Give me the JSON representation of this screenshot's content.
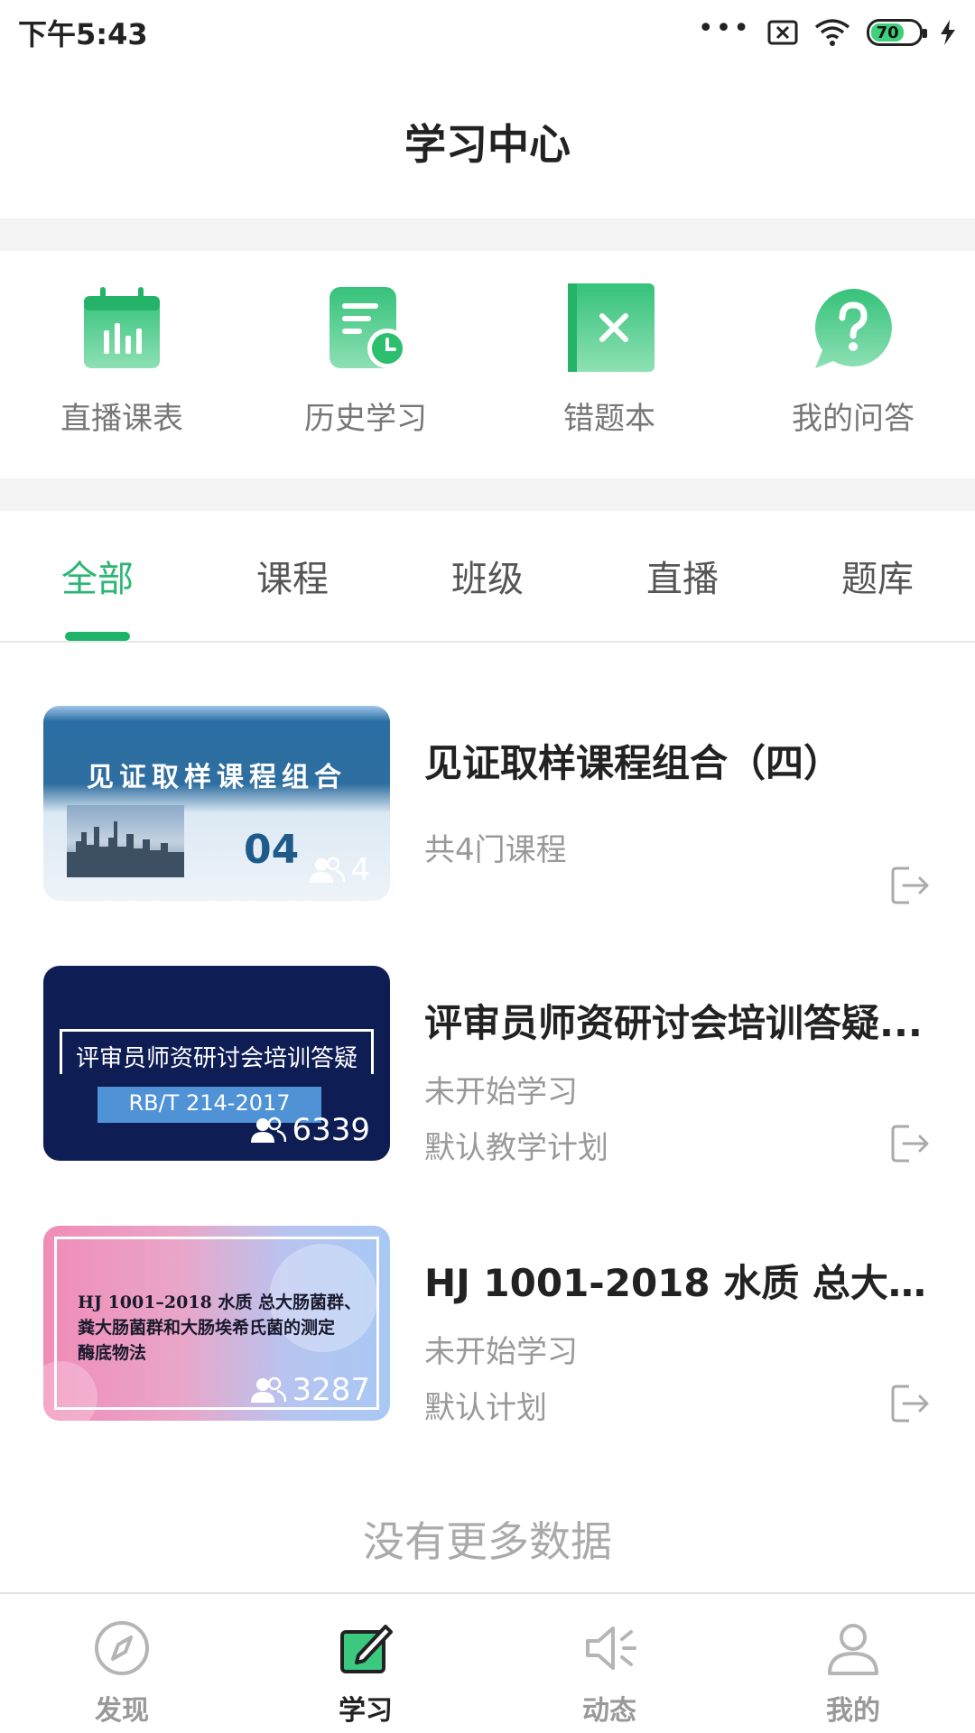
{
  "status_bar": {
    "time": "下午5:43",
    "battery": "70"
  },
  "header": {
    "title": "学习中心"
  },
  "shortcuts": [
    {
      "label": "直播课表",
      "icon": "calendar-chart-icon"
    },
    {
      "label": "历史学习",
      "icon": "history-clock-icon"
    },
    {
      "label": "错题本",
      "icon": "wrong-book-icon"
    },
    {
      "label": "我的问答",
      "icon": "question-bubble-icon"
    }
  ],
  "tabs": [
    {
      "label": "全部",
      "active": true
    },
    {
      "label": "课程",
      "active": false
    },
    {
      "label": "班级",
      "active": false
    },
    {
      "label": "直播",
      "active": false
    },
    {
      "label": "题库",
      "active": false
    }
  ],
  "courses": [
    {
      "title": "见证取样课程组合（四）",
      "lines": [
        "共4门课程"
      ],
      "thumb_title": "见证取样课程组合",
      "thumb_number": "04",
      "thumb_users": "4"
    },
    {
      "title": "评审员师资研讨会培训答疑...",
      "lines": [
        "未开始学习",
        "默认教学计划"
      ],
      "thumb_title": "评审员师资研讨会培训答疑",
      "thumb_code": "RB/T 214-2017",
      "thumb_users": "6339"
    },
    {
      "title": "HJ 1001-2018 水质 总大肠...",
      "lines": [
        "未开始学习",
        "默认计划"
      ],
      "thumb_title_lines": [
        "HJ 1001–2018 水质 总大肠菌群、",
        "粪大肠菌群和大肠埃希氏菌的测定",
        "酶底物法"
      ],
      "thumb_users": "3287"
    }
  ],
  "footer": {
    "no_more": "没有更多数据"
  },
  "bottom_nav": [
    {
      "label": "发现",
      "icon": "compass-icon",
      "active": false
    },
    {
      "label": "学习",
      "icon": "study-pen-icon",
      "active": true
    },
    {
      "label": "动态",
      "icon": "speaker-icon",
      "active": false
    },
    {
      "label": "我的",
      "icon": "profile-icon",
      "active": false
    }
  ],
  "colors": {
    "accent": "#1fb36a",
    "icon_green_light": "#7fdca8",
    "icon_green_dark": "#2bbf6e"
  }
}
